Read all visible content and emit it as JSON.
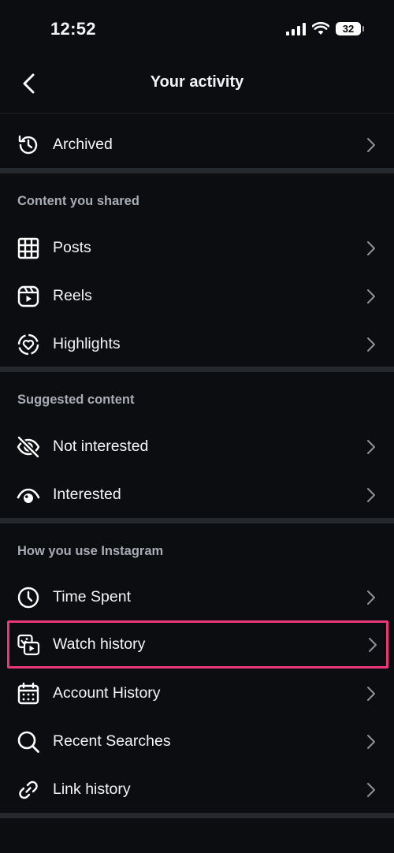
{
  "status_bar": {
    "time": "12:52",
    "battery": "32"
  },
  "nav": {
    "title": "Your activity"
  },
  "archived": {
    "label": "Archived"
  },
  "sections": [
    {
      "header": "Content you shared",
      "items": [
        "Posts",
        "Reels",
        "Highlights"
      ]
    },
    {
      "header": "Suggested content",
      "items": [
        "Not interested",
        "Interested"
      ]
    },
    {
      "header": "How you use Instagram",
      "items": [
        "Time Spent",
        "Watch history",
        "Account History",
        "Recent Searches",
        "Link history"
      ]
    }
  ],
  "colors": {
    "background": "#0b0d10",
    "divider": "#25282d",
    "highlight": "#e9387a",
    "secondary_text": "#a8adb5"
  },
  "icons": [
    "back-arrow-icon",
    "archive-history-icon",
    "grid-icon",
    "reels-icon",
    "highlights-icon",
    "eye-off-icon",
    "eye-icon",
    "clock-icon",
    "watch-history-icon",
    "calendar-icon",
    "search-icon",
    "link-icon",
    "chevron-right-icon"
  ]
}
